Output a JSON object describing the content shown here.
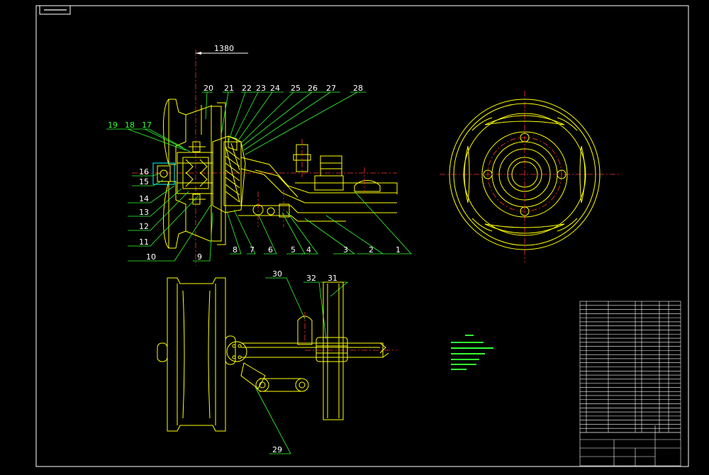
{
  "dimension_text": "1380",
  "labels_top": [
    "20",
    "21",
    "22",
    "23",
    "24",
    "25",
    "26",
    "27",
    "28"
  ],
  "labels_left": [
    "19",
    "18",
    "17",
    "16",
    "15",
    "14",
    "13",
    "12",
    "11",
    "10"
  ],
  "labels_bottom": [
    "9",
    "8",
    "7",
    "6",
    "5",
    "4",
    "3",
    "2",
    "1"
  ],
  "labels_lower": [
    "30",
    "32",
    "31",
    "29"
  ],
  "colors": {
    "frame": "#ffffff",
    "part": "#ffff00",
    "leader": "#33ff33",
    "center": "#ff3333"
  }
}
